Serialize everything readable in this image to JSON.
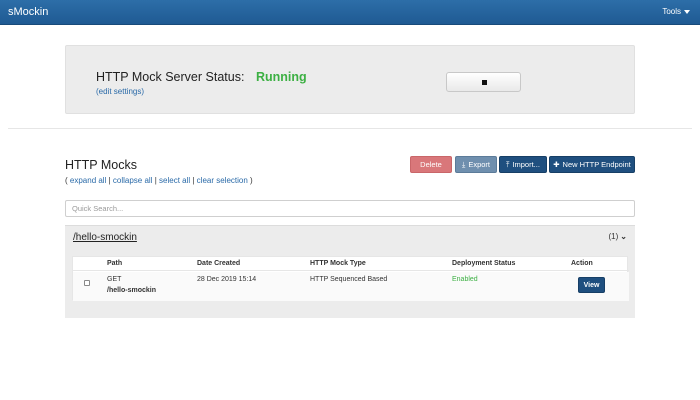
{
  "navbar": {
    "brand": "sMockin",
    "tools_label": "Tools"
  },
  "status": {
    "label": "HTTP Mock Server Status:",
    "value": "Running",
    "value_color": "#3cb043",
    "edit_settings_link": "(edit settings)",
    "stop_button_icon": "stop-square-icon"
  },
  "mocks": {
    "title": "HTTP Mocks",
    "links": {
      "open": "( ",
      "expand_all": "expand all",
      "sep": " | ",
      "collapse_all": "collapse all",
      "select_all": "select all",
      "clear_selection": "clear selection",
      "close": " )"
    },
    "buttons": {
      "delete": "Delete",
      "export": "Export",
      "import": "Import...",
      "new_endpoint": "New HTTP Endpoint"
    },
    "search": {
      "placeholder": "Quick Search...",
      "value": ""
    },
    "groups": [
      {
        "name": "/hello-smockin",
        "count": "(1)",
        "columns": [
          "Path",
          "Date Created",
          "HTTP Mock Type",
          "Deployment Status",
          "Action"
        ],
        "rows": [
          {
            "method": "GET",
            "path": "/hello-smockin",
            "date_created": "28 Dec 2019 15:14",
            "mock_type": "HTTP Sequenced Based",
            "deployment_status": "Enabled",
            "action": "View"
          }
        ]
      }
    ]
  },
  "colors": {
    "navbar": "#1f5a93",
    "delete": "#d9777a",
    "export": "#6f8fae",
    "primary": "#1f4f7f",
    "enabled": "#3cb043",
    "link": "#2a6aa8"
  }
}
